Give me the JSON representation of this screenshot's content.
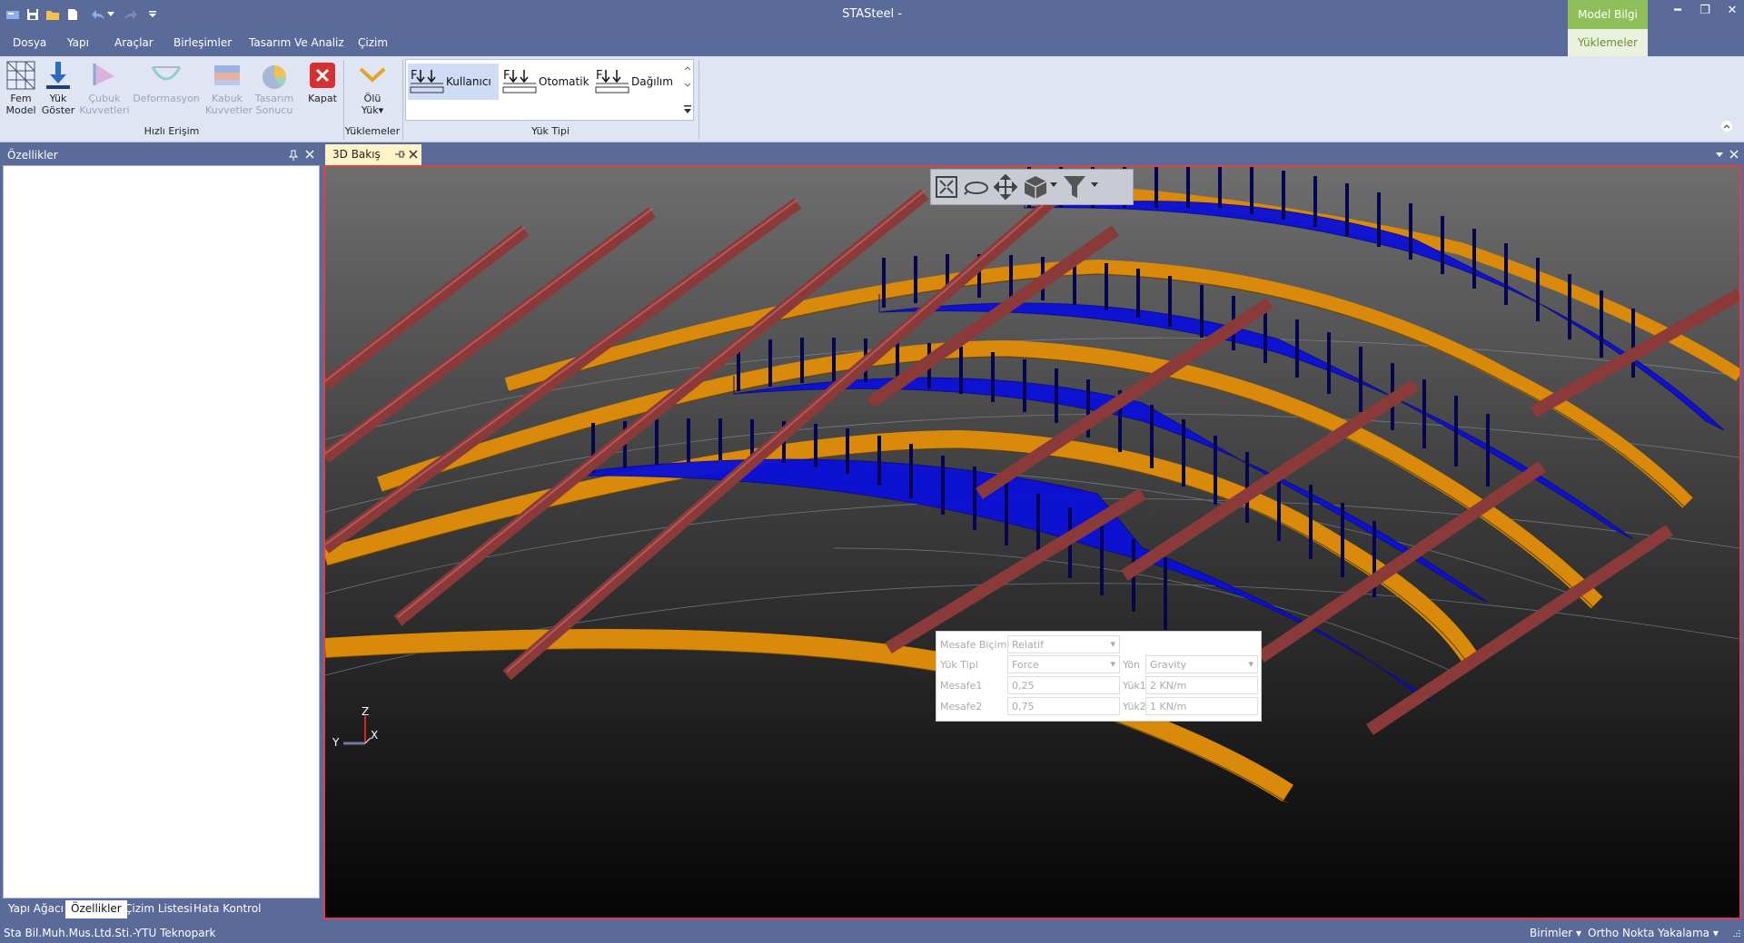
{
  "window": {
    "title": "STASteel -",
    "minimize": "━",
    "restore": "❐",
    "close": "✕"
  },
  "context_tabs": {
    "model_info": "Model Bilgi",
    "loads": "Yüklemeler"
  },
  "menu": [
    "Dosya",
    "Yapı",
    "Araçlar",
    "Birleşimler",
    "Tasarım Ve Analiz",
    "Çizim"
  ],
  "ribbon": {
    "quick_access": {
      "label": "Hızlı Erişim",
      "buttons": [
        {
          "line1": "Fem",
          "line2": "Model",
          "enabled": true
        },
        {
          "line1": "Yük",
          "line2": "Göster",
          "enabled": true
        },
        {
          "line1": "Çubuk",
          "line2": "Kuvvetleri",
          "enabled": false
        },
        {
          "line1": "Deformasyon",
          "line2": "",
          "enabled": false
        },
        {
          "line1": "Kabuk",
          "line2": "Kuvvetler",
          "enabled": false
        },
        {
          "line1": "Tasarım",
          "line2": "Sonucu",
          "enabled": false
        },
        {
          "line1": "Kapat",
          "line2": "",
          "enabled": true
        }
      ]
    },
    "loads_group": {
      "label": "Yüklemeler",
      "dead_load": {
        "line1": "Ölü",
        "line2": "Yük▾"
      }
    },
    "load_type_group": {
      "label": "Yük Tipi",
      "items": [
        "Kullanıcı",
        "Otomatik",
        "Dağılım"
      ],
      "selected": "Kullanıcı"
    }
  },
  "left_panel": {
    "title": "Özellikler",
    "tabs": [
      "Yapı Ağacı",
      "Özellikler",
      "Çizim Listesi",
      "Hata Kontrol"
    ],
    "active_tab": "Özellikler"
  },
  "document": {
    "tab_label": "3D Bakış"
  },
  "load_popup": {
    "distance_format_label": "Mesafe Biçimi",
    "distance_format_value": "Relatif",
    "load_type_label": "Yük Tipi",
    "load_type_value": "Force",
    "direction_label": "Yön",
    "direction_value": "Gravity",
    "distance1_label": "Mesafe1",
    "distance1_value": "0,25",
    "load1_label": "Yük1",
    "load1_value": "2 KN/m",
    "distance2_label": "Mesafe2",
    "distance2_value": "0,75",
    "load2_label": "Yük2",
    "load2_value": "1 KN/m"
  },
  "axes": {
    "z": "Z",
    "y": "Y",
    "x": "X"
  },
  "status": {
    "company": "Sta Bil.Muh.Mus.Ltd.Sti.-YTU Teknopark",
    "units": "Birimler",
    "ortho": "Ortho",
    "snap": "Nokta Yakalama"
  },
  "colors": {
    "frame": "#5b6b99",
    "ribbon": "#dfe5f3",
    "beam_orange": "#d98a0a",
    "purlin_red": "#8b3a3a",
    "load_blue": "#0a10d8",
    "context_green": "#8fbf5a"
  }
}
